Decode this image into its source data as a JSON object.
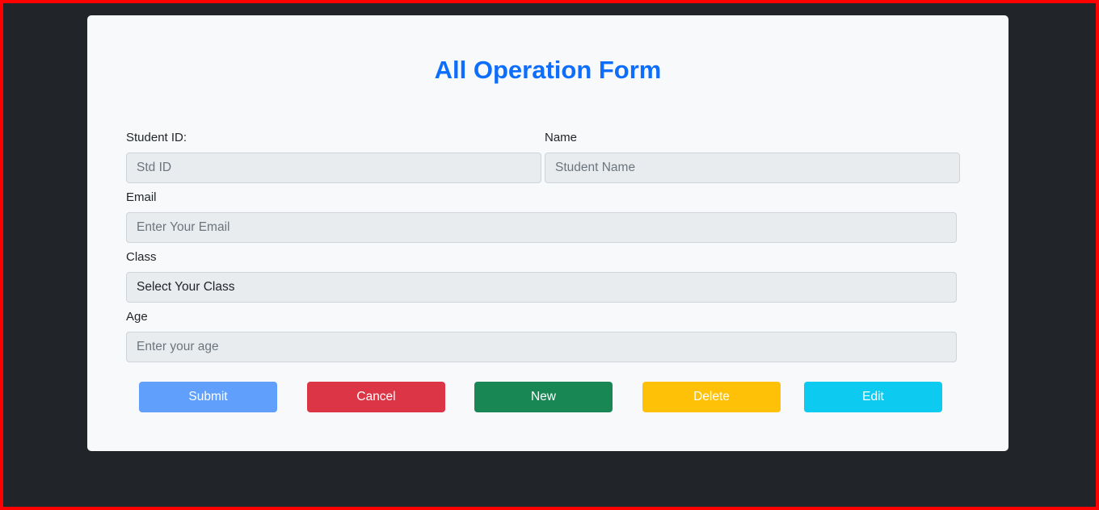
{
  "title": "All Operation Form",
  "fields": {
    "student_id": {
      "label": "Student ID:",
      "placeholder": "Std ID"
    },
    "name": {
      "label": "Name",
      "placeholder": "Student Name"
    },
    "email": {
      "label": "Email",
      "placeholder": "Enter Your Email"
    },
    "class": {
      "label": "Class",
      "value": "Select Your Class"
    },
    "age": {
      "label": "Age",
      "placeholder": "Enter your age"
    }
  },
  "buttons": {
    "submit": "Submit",
    "cancel": "Cancel",
    "new": "New",
    "delete": "Delete",
    "edit": "Edit"
  },
  "colors": {
    "submit": "#60a0fc",
    "cancel": "#dc3545",
    "new": "#198754",
    "delete": "#ffc107",
    "edit": "#0dcaf0",
    "title": "#0d6efd"
  }
}
